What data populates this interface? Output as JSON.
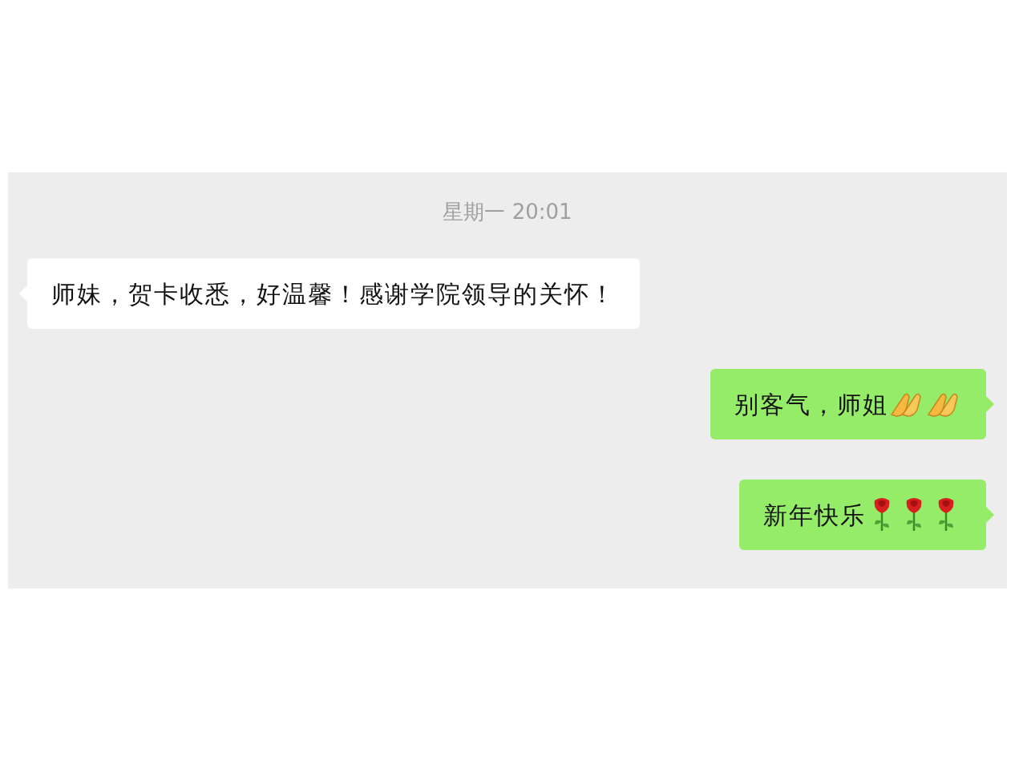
{
  "timestamp": "星期一 20:01",
  "messages": [
    {
      "kind": "incoming",
      "text": "师妹，贺卡收悉，好温馨！感谢学院领导的关怀！"
    },
    {
      "kind": "outgoing",
      "text": "别客气，师姐",
      "emoji": [
        {
          "kind": "praying-hands"
        },
        {
          "kind": "praying-hands"
        }
      ]
    },
    {
      "kind": "outgoing",
      "text": "新年快乐",
      "emoji": [
        {
          "kind": "rose"
        },
        {
          "kind": "rose"
        },
        {
          "kind": "rose"
        }
      ]
    }
  ]
}
